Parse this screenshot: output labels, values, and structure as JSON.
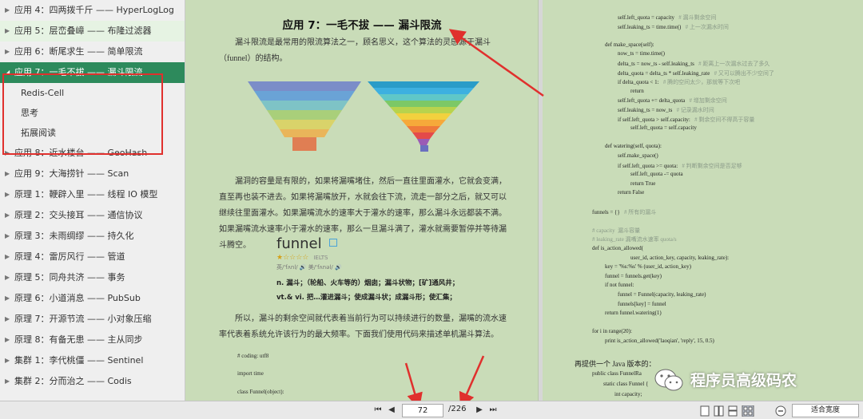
{
  "sidebar": {
    "items_before": [
      {
        "label": "应用 4：四两拨千斤 —— HyperLogLog",
        "highlight": false
      },
      {
        "label": "应用 5：层峦叠嶂 —— 布隆过滤器",
        "highlight": true
      },
      {
        "label": "应用 6：断尾求生 —— 简单限流",
        "highlight": false
      }
    ],
    "active_item": {
      "label": "应用 7：一毛不拔 —— 漏斗限流"
    },
    "sub_items": [
      "Redis-Cell",
      "思考",
      "拓展阅读"
    ],
    "items_after": [
      "应用 8：近水楼台 —— GeoHash",
      "应用 9：大海捞针 —— Scan",
      "原理 1：鞭辟入里 —— 线程 IO 模型",
      "原理 2：交头接耳 —— 通信协议",
      "原理 3：未雨绸缪 —— 持久化",
      "原理 4：雷厉风行 —— 管道",
      "原理 5：同舟共济 —— 事务",
      "原理 6：小道消息 —— PubSub",
      "原理 7：开源节流 —— 小对象压缩",
      "原理 8：有备无患 —— 主从同步",
      "集群 1：李代桃僵 —— Sentinel",
      "集群 2：分而治之 —— Codis"
    ]
  },
  "left_page": {
    "title": "应用 7：一毛不拔 —— 漏斗限流",
    "intro": "漏斗限流是最常用的限流算法之一，顾名思义，这个算法的灵感源于漏斗（funnel）的结构。",
    "para2": "漏洞的容量是有限的，如果将漏嘴堵住，然后一直往里面灌水，它就会变满，直至再也装不进去。如果将漏嘴放开，水就会往下流，流走一部分之后，就又可以继续往里面灌水。如果漏嘴流水的速率大于灌水的速率，那么漏斗永远都装不满。如果漏嘴流水速率小于灌水的速率，那么一旦漏斗满了，灌水就需要暂停并等待漏斗腾空。",
    "dict": {
      "word": "funnel",
      "stars": "★☆☆☆☆",
      "tag": "IELTS",
      "phonetic": "英/'fʌnl/ 🔊  美/'fʌnəl/ 🔊",
      "def1": "n. 漏斗；（轮船、火车等的）烟囱；漏斗状物；[矿]通风井；",
      "def2": "vt.& vi. 把…灌进漏斗；使成漏斗状；成漏斗形；使汇集；"
    },
    "para3": "所以，漏斗的剩余空间就代表着当前行为可以持续进行的数量，漏嘴的流水速率代表着系统允许该行为的最大频率。下面我们使用代码来描述单机漏斗算法。",
    "code": [
      "# coding: utf8",
      "import time",
      "class Funnel(object):"
    ]
  },
  "right_page": {
    "code_top": [
      {
        "t": "self.left_quota = capacity",
        "c": "# 漏斗剩余空间",
        "i": 3
      },
      {
        "t": "self.leaking_ts = time.time()",
        "c": "# 上一次漏水时间",
        "i": 3
      },
      {
        "t": "",
        "c": "",
        "i": 0
      },
      {
        "t": "def make_space(self):",
        "c": "",
        "i": 2
      },
      {
        "t": "now_ts = time.time()",
        "c": "",
        "i": 3
      },
      {
        "t": "delta_ts = now_ts - self.leaking_ts",
        "c": "# 距离上一次漏水过去了多久",
        "i": 3
      },
      {
        "t": "delta_quota = delta_ts * self.leaking_rate",
        "c": "# 又可以腾出不少空间了",
        "i": 3
      },
      {
        "t": "if delta_quota < 1:",
        "c": "# 腾的空间太少，那就等下次吧",
        "i": 3
      },
      {
        "t": "return",
        "c": "",
        "i": 4
      },
      {
        "t": "self.left_quota += delta_quota",
        "c": "# 增加剩余空间",
        "i": 3
      },
      {
        "t": "self.leaking_ts = now_ts",
        "c": "# 记录漏水时间",
        "i": 3
      },
      {
        "t": "if self.left_quota > self.capacity:",
        "c": "# 剩余空间不得高于容量",
        "i": 3
      },
      {
        "t": "self.left_quota = self.capacity",
        "c": "",
        "i": 4
      },
      {
        "t": "",
        "c": "",
        "i": 0
      },
      {
        "t": "def watering(self, quota):",
        "c": "",
        "i": 2
      },
      {
        "t": "self.make_space()",
        "c": "",
        "i": 3
      },
      {
        "t": "if self.left_quota >= quota:",
        "c": "# 判断剩余空间是否足够",
        "i": 3
      },
      {
        "t": "self.left_quota -= quota",
        "c": "",
        "i": 4
      },
      {
        "t": "return True",
        "c": "",
        "i": 4
      },
      {
        "t": "return False",
        "c": "",
        "i": 3
      },
      {
        "t": "",
        "c": "",
        "i": 0
      },
      {
        "t": "funnels = {}",
        "c": "# 所有的漏斗",
        "i": 1
      },
      {
        "t": "",
        "c": "",
        "i": 0
      },
      {
        "t": "",
        "c": "# capacity  漏斗容量",
        "i": 1
      },
      {
        "t": "",
        "c": "# leaking_rate 漏嘴流水速率 quota/s",
        "i": 1
      },
      {
        "t": "def is_action_allowed(",
        "c": "",
        "i": 1
      },
      {
        "t": "user_id, action_key, capacity, leaking_rate):",
        "c": "",
        "i": 4
      },
      {
        "t": "key = '%s:%s' % (user_id, action_key)",
        "c": "",
        "i": 2
      },
      {
        "t": "funnel = funnels.get(key)",
        "c": "",
        "i": 2
      },
      {
        "t": "if not funnel:",
        "c": "",
        "i": 2
      },
      {
        "t": "funnel = Funnel(capacity, leaking_rate)",
        "c": "",
        "i": 3
      },
      {
        "t": "funnels[key] = funnel",
        "c": "",
        "i": 3
      },
      {
        "t": "return funnel.watering(1)",
        "c": "",
        "i": 2
      },
      {
        "t": "",
        "c": "",
        "i": 0
      },
      {
        "t": "for i in range(20):",
        "c": "",
        "i": 1
      },
      {
        "t": "print is_action_allowed('laoqian', 'reply', 15, 0.5)",
        "c": "",
        "i": 2
      }
    ],
    "java_intro": "再提供一个 Java 版本的：",
    "java_code": [
      "public class FunnelRa",
      "static class Funnel {",
      "int capacity;"
    ]
  },
  "toolbar": {
    "current_page": "72",
    "total_pages": "/226",
    "zoom": "适合宽度",
    "first": "⏮",
    "prev": "◀",
    "next": "▶",
    "last": "⏭"
  },
  "watermark": {
    "text": "程序员高级码农"
  },
  "colors": {
    "page_bg": "#c9dcb8",
    "active": "#2d8a5c",
    "annotation": "#e0302d"
  }
}
